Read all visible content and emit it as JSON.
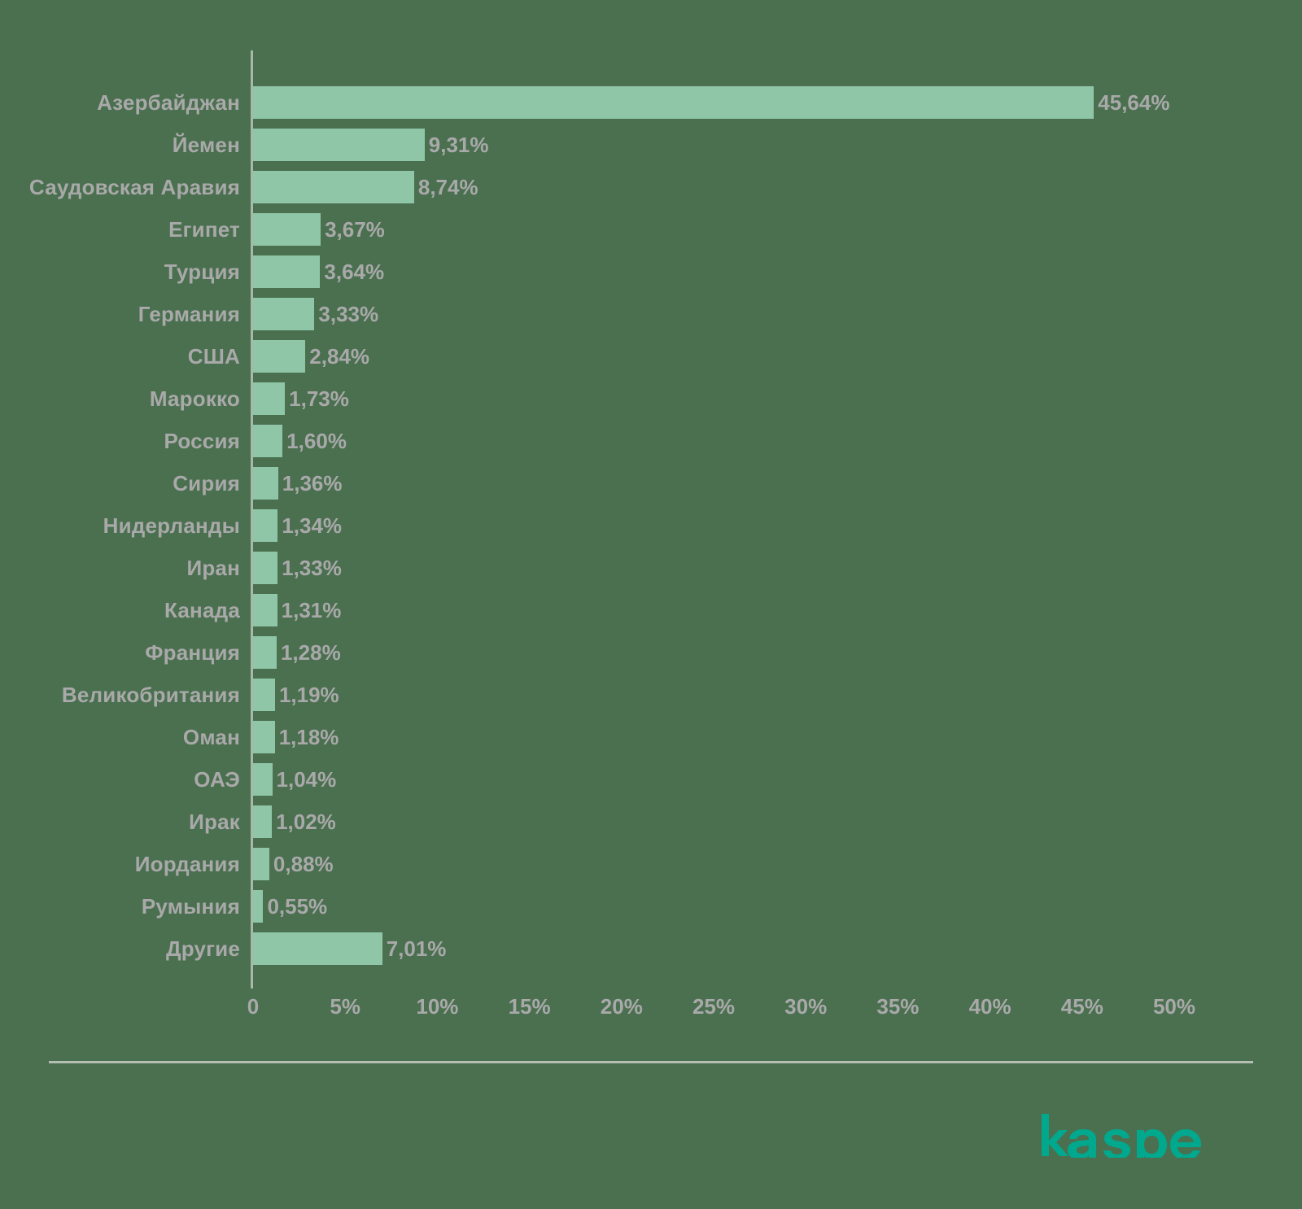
{
  "chart_data": {
    "type": "bar",
    "orientation": "horizontal",
    "title": "",
    "subtitle": "",
    "xlabel": "",
    "ylabel": "",
    "xlim": [
      0,
      50
    ],
    "grid": false,
    "legend": null,
    "value_suffix": "%",
    "decimal_separator": ",",
    "categories": [
      "Азербайджан",
      "Йемен",
      "Саудовская Аравия",
      "Египет",
      "Турция",
      "Германия",
      "США",
      "Марокко",
      "Россия",
      "Сирия",
      "Нидерланды",
      "Иран",
      "Канада",
      "Франция",
      "Великобритания",
      "Оман",
      "ОАЭ",
      "Ирак",
      "Иордания",
      "Румыния",
      "Другие"
    ],
    "values": [
      45.64,
      9.31,
      8.74,
      3.67,
      3.64,
      3.33,
      2.84,
      1.73,
      1.6,
      1.36,
      1.34,
      1.33,
      1.31,
      1.28,
      1.19,
      1.18,
      1.04,
      1.02,
      0.88,
      0.55,
      7.01
    ],
    "value_labels": [
      "45,64%",
      "9,31%",
      "8,74%",
      "3,67%",
      "3,64%",
      "3,33%",
      "2,84%",
      "1,73%",
      "1,60%",
      "1,36%",
      "1,34%",
      "1,33%",
      "1,31%",
      "1,28%",
      "1,19%",
      "1,18%",
      "1,04%",
      "1,02%",
      "0,88%",
      "0,55%",
      "7,01%"
    ],
    "xticks": [
      {
        "value": 0,
        "label": "0"
      },
      {
        "value": 5,
        "label": "5%"
      },
      {
        "value": 10,
        "label": "10%"
      },
      {
        "value": 15,
        "label": "15%"
      },
      {
        "value": 20,
        "label": "20%"
      },
      {
        "value": 25,
        "label": "25%"
      },
      {
        "value": 30,
        "label": "30%"
      },
      {
        "value": 35,
        "label": "35%"
      },
      {
        "value": 40,
        "label": "40%"
      },
      {
        "value": 45,
        "label": "45%"
      },
      {
        "value": 50,
        "label": "50%"
      }
    ]
  },
  "colors": {
    "background": "#4a7050",
    "bar": "#8fc6a7",
    "text": "#a9a9a9",
    "axis_line": "#a8b8a9",
    "divider": "#b4bfb4",
    "brand": "#00a88e"
  },
  "footer": {
    "brand_name": "kaspersky",
    "brand_icon": "kaspersky-wordmark"
  }
}
